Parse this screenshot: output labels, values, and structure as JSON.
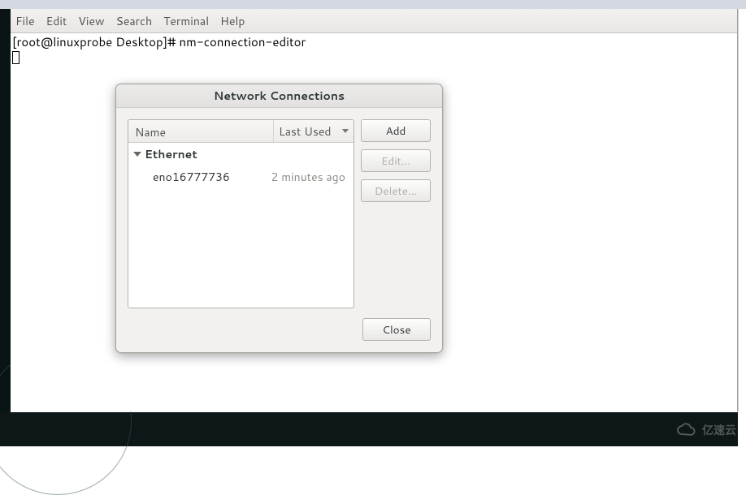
{
  "menubar": {
    "items": [
      "File",
      "Edit",
      "View",
      "Search",
      "Terminal",
      "Help"
    ]
  },
  "terminal": {
    "prompt": "[root@linuxprobe Desktop]# ",
    "command": "nm-connection-editor"
  },
  "dialog": {
    "title": "Network Connections",
    "columns": {
      "name": "Name",
      "last_used": "Last Used"
    },
    "group": "Ethernet",
    "connection": {
      "name": "eno16777736",
      "last_used": "2 minutes ago"
    },
    "buttons": {
      "add": "Add",
      "edit": "Edit...",
      "delete": "Delete...",
      "close": "Close"
    }
  },
  "watermark": {
    "text": "亿速云"
  }
}
